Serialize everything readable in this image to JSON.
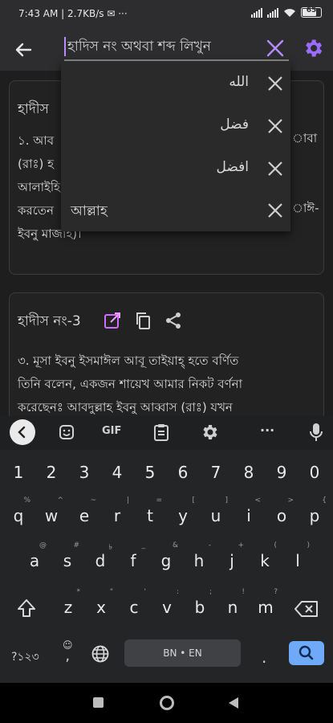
{
  "status_bar": {
    "time": "7:43 AM",
    "speed": "2.7KB/s",
    "extra": "···",
    "battery": "65"
  },
  "search": {
    "value": "",
    "placeholder": "হাদিস নং অথবা শব্দ লিখুন"
  },
  "suggestions": [
    {
      "text": "الله",
      "dir": "rtl"
    },
    {
      "text": "فضل",
      "dir": "rtl"
    },
    {
      "text": "افضل",
      "dir": "rtl"
    },
    {
      "text": "আল্লাহ",
      "dir": "ltr"
    }
  ],
  "card1": {
    "title": "হাদীস",
    "lines": [
      "১. আব",
      "(রাঃ) হ",
      "আলাইহি",
      "করতেন",
      "ইবনু মাজাহ)।"
    ],
    "right_frags": [
      "াবা",
      "াঈ-"
    ]
  },
  "card2": {
    "title": "হাদীস নং-3",
    "lines": [
      "৩. মূসা ইবনু ইসমাঈল আবূ তাইয়াহ্ হতে বর্ণিত",
      "তিনি বলেন, একজন শায়েখ আমার নিকট বর্ণনা",
      "করেছেনঃ আবদুল্লাহ ইবনু আব্বাস (রাঃ) যখন"
    ]
  },
  "keyboard": {
    "toolbar": {
      "gif": "GIF",
      "more": "···"
    },
    "rows": {
      "numbers": [
        "1",
        "2",
        "3",
        "4",
        "5",
        "6",
        "7",
        "8",
        "9",
        "0"
      ],
      "row1": [
        "q",
        "w",
        "e",
        "r",
        "t",
        "y",
        "u",
        "i",
        "o",
        "p"
      ],
      "row1_hints": [
        "%",
        "^",
        "~",
        "|",
        "=",
        "[",
        "]",
        "<",
        ">",
        "{"
      ],
      "row2": [
        "a",
        "s",
        "d",
        "f",
        "g",
        "h",
        "j",
        "k",
        "l"
      ],
      "row2_hints": [
        "@",
        "#",
        "৳",
        "_",
        "&",
        "-",
        "+",
        "(",
        ")"
      ],
      "row3": [
        "z",
        "x",
        "c",
        "v",
        "b",
        "n",
        "m"
      ],
      "row3_hints": [
        "*",
        "\"",
        "'",
        ":",
        ";",
        "!",
        "?"
      ]
    },
    "symbols_label": "?১২৩",
    "comma_label": ",",
    "space_label": "BN • EN",
    "period_label": "."
  },
  "colors": {
    "accent": "#b48cff",
    "gear": "#9c6cff",
    "search_key": "#6eaaf7",
    "open_link": "#d06cff"
  }
}
